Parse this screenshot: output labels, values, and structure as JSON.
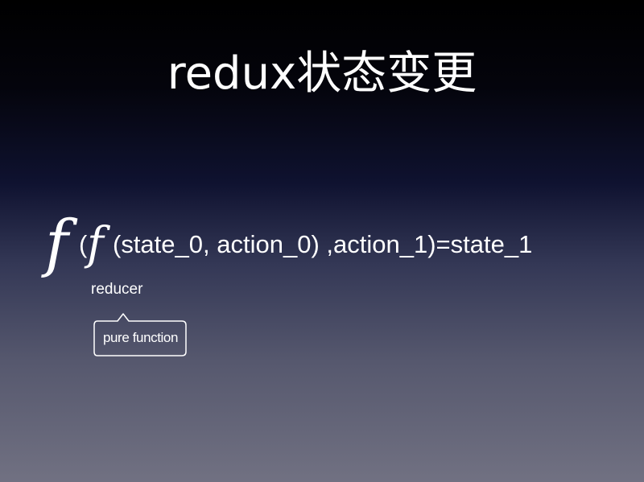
{
  "slide": {
    "title": "redux状态变更",
    "formula": {
      "outer_function": "f",
      "open_paren": "(",
      "inner_function": "f",
      "expression": "(state_0, action_0) ,action_1)=state_1"
    },
    "reducer_label": "reducer",
    "callout_text": "pure function"
  }
}
